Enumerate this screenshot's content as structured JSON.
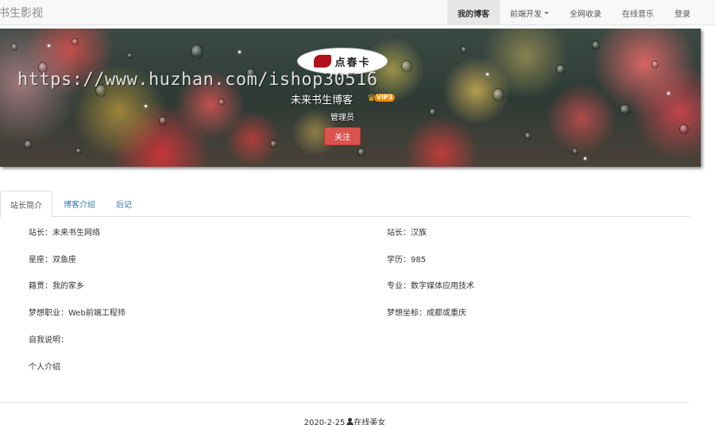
{
  "navbar": {
    "brand": "书生影视",
    "items": [
      {
        "label": "我的博客",
        "active": true
      },
      {
        "label": "前端开发",
        "dropdown": true
      },
      {
        "label": "全网收录"
      },
      {
        "label": "在线音乐"
      },
      {
        "label": "登录"
      }
    ]
  },
  "banner": {
    "logo_text": "点春卡",
    "watermark": "https://www.huzhan.com/ishop30516",
    "user_name": "未来书生博客",
    "vip_label": "VIP3",
    "role": "管理员",
    "follow_label": "关注"
  },
  "tabs": [
    {
      "label": "站长简介",
      "active": true
    },
    {
      "label": "博客介绍"
    },
    {
      "label": "后记"
    }
  ],
  "info": {
    "left": [
      "站长：未来书生网络",
      "星座：双鱼座",
      "籍贯：我的家乡",
      "梦想职业：Web前端工程师",
      "自我说明：",
      "个人介绍"
    ],
    "right": [
      "站长：汉族",
      "学历：985",
      "专业：数字媒体应用技术",
      "梦想坐标：成都或重庆"
    ]
  },
  "footer": {
    "date": "2020-2-25",
    "author": "在线美女"
  },
  "colors": {
    "follow_button": "#d9534f",
    "tab_link": "#337ab7",
    "nav_active_bg": "#e7e7e7"
  }
}
